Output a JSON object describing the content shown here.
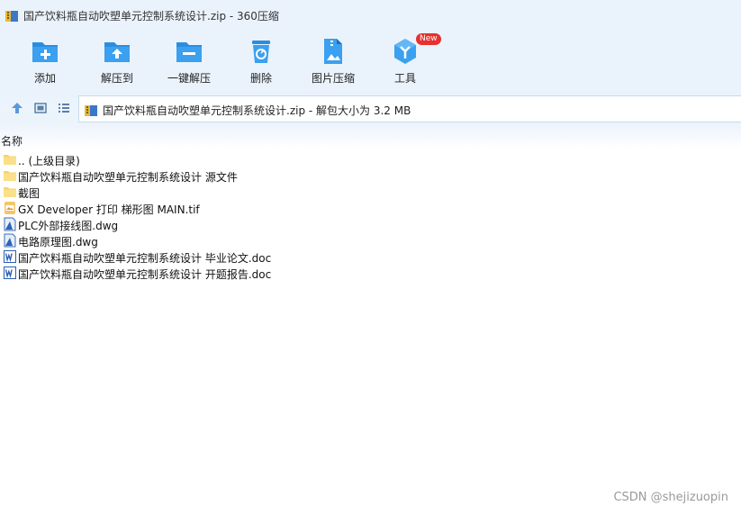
{
  "window": {
    "title": "国产饮料瓶自动吹塑单元控制系统设计.zip - 360压缩"
  },
  "toolbar": {
    "items": [
      {
        "label": "添加",
        "icon": "add-folder-icon"
      },
      {
        "label": "解压到",
        "icon": "extract-to-icon"
      },
      {
        "label": "一键解压",
        "icon": "one-click-extract-icon"
      },
      {
        "label": "删除",
        "icon": "trash-icon"
      },
      {
        "label": "图片压缩",
        "icon": "image-compress-icon"
      },
      {
        "label": "工具",
        "icon": "tools-icon",
        "badge": "New"
      }
    ]
  },
  "address": {
    "path": "国产饮料瓶自动吹塑单元控制系统设计.zip - 解包大小为 3.2 MB"
  },
  "list": {
    "column_name": "名称",
    "rows": [
      {
        "name": ".. (上级目录)",
        "icon": "folder-icon"
      },
      {
        "name": "国产饮料瓶自动吹塑单元控制系统设计 源文件",
        "icon": "folder-icon"
      },
      {
        "name": "截图",
        "icon": "folder-icon"
      },
      {
        "name": "GX Developer 打印 梯形图 MAIN.tif",
        "icon": "tif-image-icon"
      },
      {
        "name": "PLC外部接线图.dwg",
        "icon": "dwg-file-icon"
      },
      {
        "name": "电路原理图.dwg",
        "icon": "dwg-file-icon"
      },
      {
        "name": "国产饮料瓶自动吹塑单元控制系统设计 毕业论文.doc",
        "icon": "word-doc-icon"
      },
      {
        "name": "国产饮料瓶自动吹塑单元控制系统设计 开题报告.doc",
        "icon": "word-doc-icon"
      }
    ]
  },
  "watermark": "CSDN @shejizuopin",
  "colors": {
    "accent": "#2a8ee0",
    "toolbar_bg": "#eaf3fc",
    "badge": "#e8302e",
    "folder": "#f7d36b"
  }
}
